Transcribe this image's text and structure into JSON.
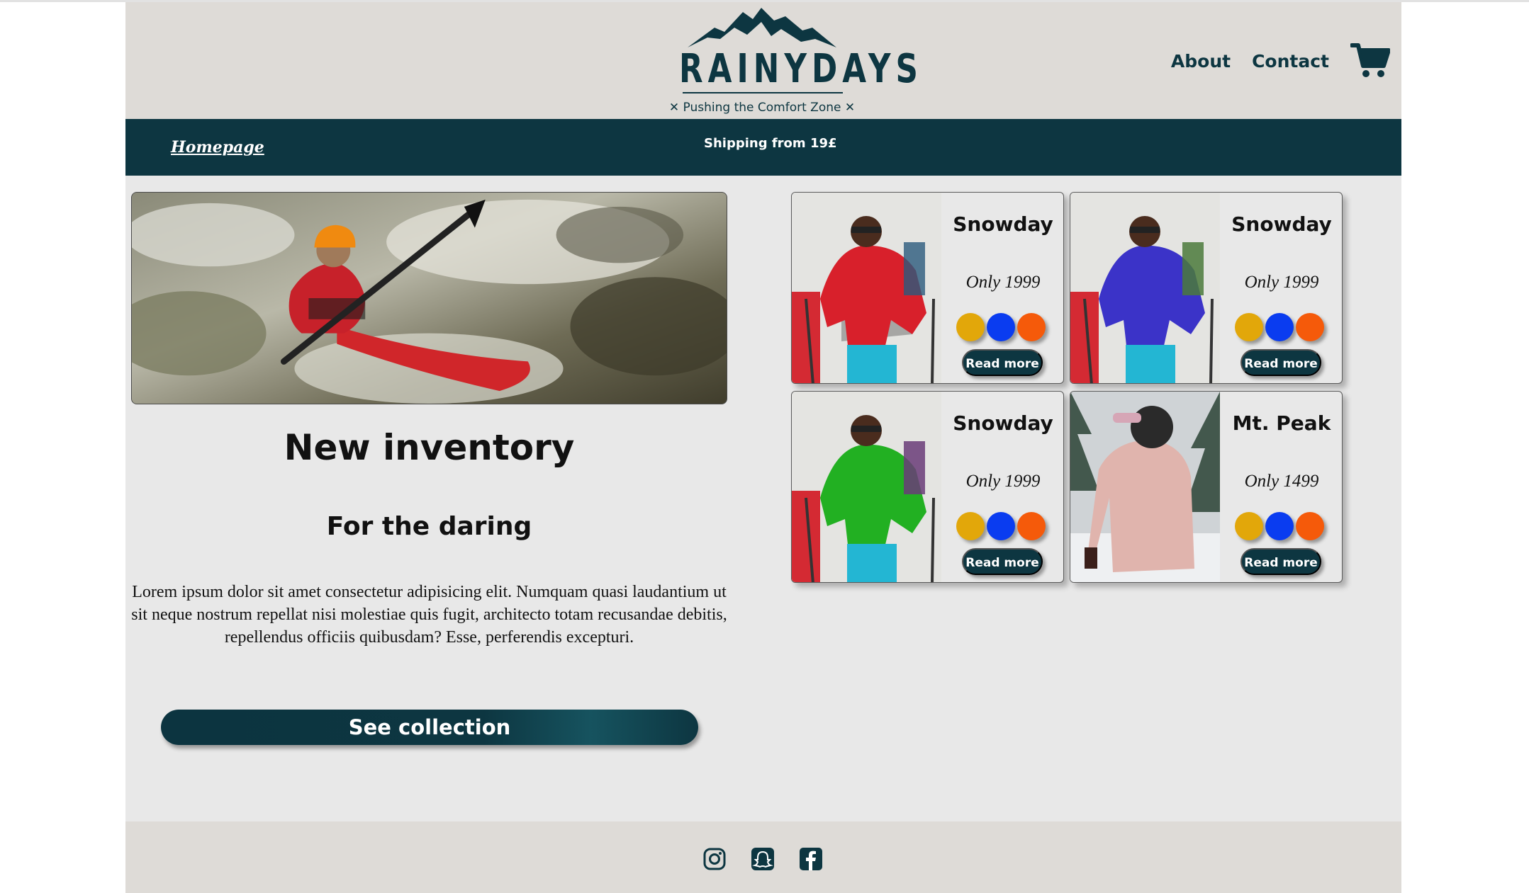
{
  "header": {
    "logo_name": "RAINYDAYS",
    "tagline": "✕ Pushing the Comfort Zone ✕",
    "nav": [
      {
        "label": "About"
      },
      {
        "label": "Contact"
      }
    ],
    "cart_icon": "shopping-cart-icon"
  },
  "bar": {
    "home_link": "Homepage",
    "shipping": "Shipping from 19£"
  },
  "main": {
    "title": "New inventory",
    "subtitle": "For the daring",
    "body": "Lorem ipsum dolor sit amet consectetur adipisicing elit. Numquam quasi laudantium ut sit neque nostrum repellat nisi molestiae quis fugit, architecto totam recusandae debitis, repellendus officiis quibusdam? Esse, perferendis excepturi.",
    "cta": "See collection"
  },
  "products": [
    {
      "name": "Snowday",
      "price": "Only 1999",
      "jacket_color": "#d8202b",
      "cta": "Read more"
    },
    {
      "name": "Snowday",
      "price": "Only 1999",
      "jacket_color": "#3b33c8",
      "cta": "Read more"
    },
    {
      "name": "Snowday",
      "price": "Only 1999",
      "jacket_color": "#22b022",
      "cta": "Read more"
    },
    {
      "name": "Mt. Peak",
      "price": "Only 1499",
      "jacket_color": "#e0b4ad",
      "cta": "Read more"
    }
  ],
  "swatch_colors": [
    "#e2a70a",
    "#0a3cf0",
    "#f55a0a"
  ],
  "colors": {
    "brand": "#0d3641",
    "header_bg": "#dedbd7",
    "page_bg": "#e8e8e8"
  },
  "footer": {
    "icons": [
      "instagram-icon",
      "snapchat-icon",
      "facebook-icon"
    ]
  }
}
